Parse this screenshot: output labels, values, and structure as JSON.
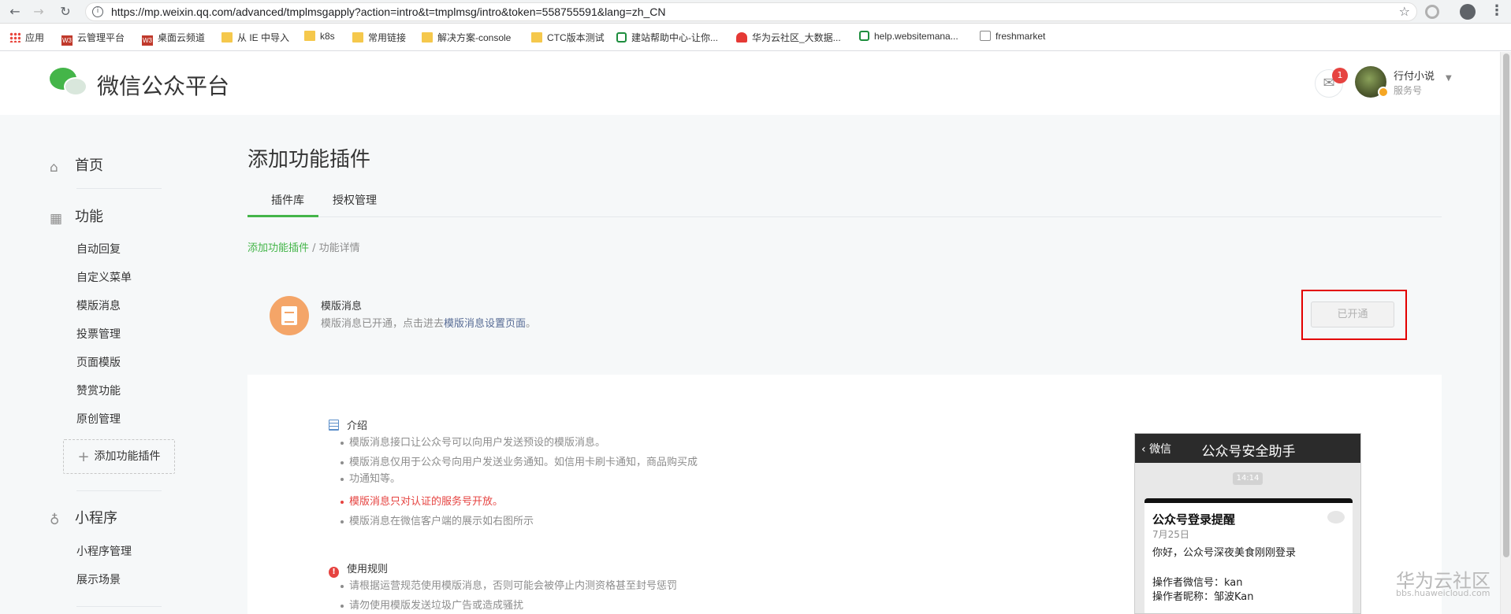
{
  "browser": {
    "url": "https://mp.weixin.qq.com/advanced/tmplmsgapply?action=intro&t=tmplmsg/intro&token=558755591&lang=zh_CN",
    "bookmarks": [
      "应用",
      "云管理平台",
      "桌面云频道",
      "从 IE 中导入",
      "k8s",
      "常用链接",
      "解决方案-console",
      "CTC版本测试",
      "建站帮助中心-让你...",
      "华为云社区_大数据...",
      "help.websitemana...",
      "freshmarket"
    ]
  },
  "header": {
    "logo_text": "微信公众平台",
    "mail_badge": "1",
    "user_name": "行付小说",
    "user_type": "服务号"
  },
  "sidebar": {
    "home": "首页",
    "functions": "功能",
    "function_items": [
      "自动回复",
      "自定义菜单",
      "模版消息",
      "投票管理",
      "页面模版",
      "赞赏功能",
      "原创管理"
    ],
    "add_plugin": "添加功能插件",
    "miniprogram": "小程序",
    "miniprogram_items": [
      "小程序管理",
      "展示场景"
    ]
  },
  "main": {
    "title": "添加功能插件",
    "tabs": [
      "插件库",
      "授权管理"
    ],
    "breadcrumb": {
      "link": "添加功能插件",
      "sep": " / ",
      "current": "功能详情"
    },
    "plugin": {
      "name": "模版消息",
      "desc_prefix": "模版消息已开通，点击进去",
      "desc_link": "模版消息设置页面",
      "desc_suffix": "。",
      "button": "已开通"
    },
    "intro": {
      "heading": "介绍",
      "bullets": [
        "模版消息接口让公众号可以向用户发送预设的模版消息。",
        "模版消息仅用于公众号向用户发送业务通知。如信用卡刷卡通知，商品购买成",
        "功通知等。",
        "模版消息只对认证的服务号开放。",
        "模版消息在微信客户端的展示如右图所示"
      ]
    },
    "rules": {
      "heading": "使用规则",
      "bullets": [
        "请根据运营规范使用模版消息，否则可能会被停止内测资格甚至封号惩罚",
        "请勿使用模版发送垃圾广告或造成骚扰"
      ]
    },
    "phone": {
      "back": "微信",
      "title": "公众号安全助手",
      "time": "14:14",
      "msg_title": "公众号登录提醒",
      "msg_date": "7月25日",
      "msg_body": "你好，公众号深夜美食刚刚登录",
      "field1": "操作者微信号：kan",
      "field2": "操作者昵称：邹波Kan"
    }
  },
  "watermark": {
    "name": "华为云社区",
    "url": "bbs.huaweicloud.com"
  }
}
